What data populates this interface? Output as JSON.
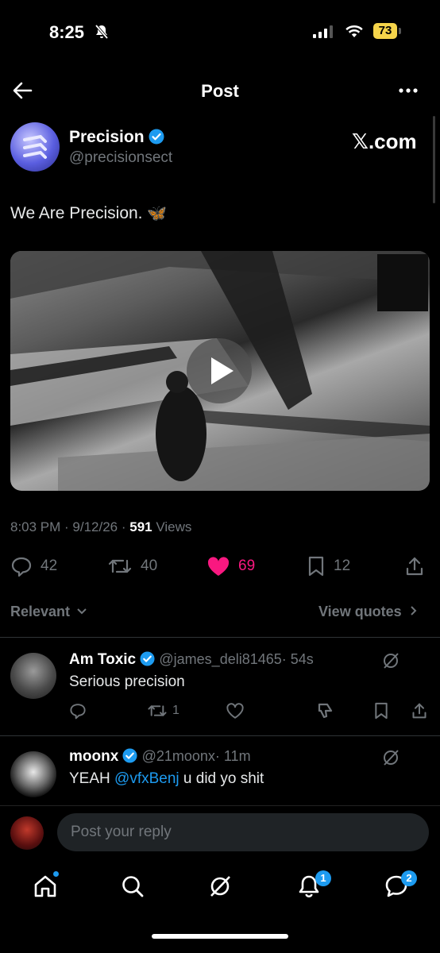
{
  "status_bar": {
    "time": "8:25",
    "battery": "73"
  },
  "header": {
    "title": "Post"
  },
  "post": {
    "author_name": "Precision",
    "author_handle": "@precisionsect",
    "source_label": "𝕏.com",
    "text": "We Are Precision.",
    "emoji": "🦋",
    "time": "8:03 PM",
    "date": "9/12/26",
    "views_count": "591",
    "views_label": "Views",
    "replies": "42",
    "reposts": "40",
    "likes": "69",
    "bookmarks": "12"
  },
  "sort": {
    "label": "Relevant",
    "view_quotes": "View quotes"
  },
  "replies": [
    {
      "name": "Am Toxic",
      "handle": "@james_deli81465",
      "time": "· 54s",
      "text": "Serious precision",
      "reposts": "1"
    },
    {
      "name": "moonx",
      "handle": "@21moonx",
      "time": "· 11m",
      "text_prefix": "YEAH ",
      "mention": "@vfxBenj",
      "text_suffix": " u did yo shit"
    }
  ],
  "reply_bar": {
    "placeholder": "Post your reply"
  },
  "tabbar": {
    "notifications_badge": "1",
    "messages_badge": "2"
  },
  "colors": {
    "accent": "#1d9bf0",
    "like": "#f91880",
    "muted": "#71767b",
    "battery": "#f5d44a"
  }
}
